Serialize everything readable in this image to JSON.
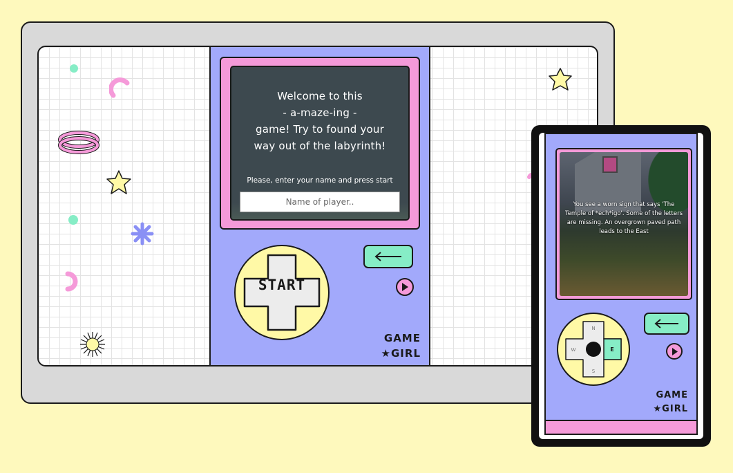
{
  "colors": {
    "page_bg": "#fef9bd",
    "console": "#a2a9fb",
    "frame_pink": "#f59ad9",
    "lcd": "#3d494f",
    "dpad_yellow": "#fff9a6",
    "button_mint": "#86edc6"
  },
  "desktop": {
    "welcome_lines": [
      "Welcome to this",
      "- a-maze-ing -",
      "game! Try to found your",
      "way out of the labyrinth!"
    ],
    "prompt": "Please, enter your name and press start",
    "name_placeholder": "Name of player..",
    "start_label": "START",
    "back_icon": "arrow-left-icon",
    "play_icon": "play-icon",
    "brand_line1": "GAME",
    "brand_line2": "★GIRL"
  },
  "mobile": {
    "scene_text": "You see a worn sign that says 'The Temple of *ech*igo'. Some of the letters are missing. An overgrown paved path leads to the East",
    "compass": {
      "n": "N",
      "s": "S",
      "w": "W",
      "e": "E"
    },
    "back_icon": "arrow-left-icon",
    "play_icon": "play-icon",
    "brand_line1": "GAME",
    "brand_line2": "★GIRL"
  }
}
